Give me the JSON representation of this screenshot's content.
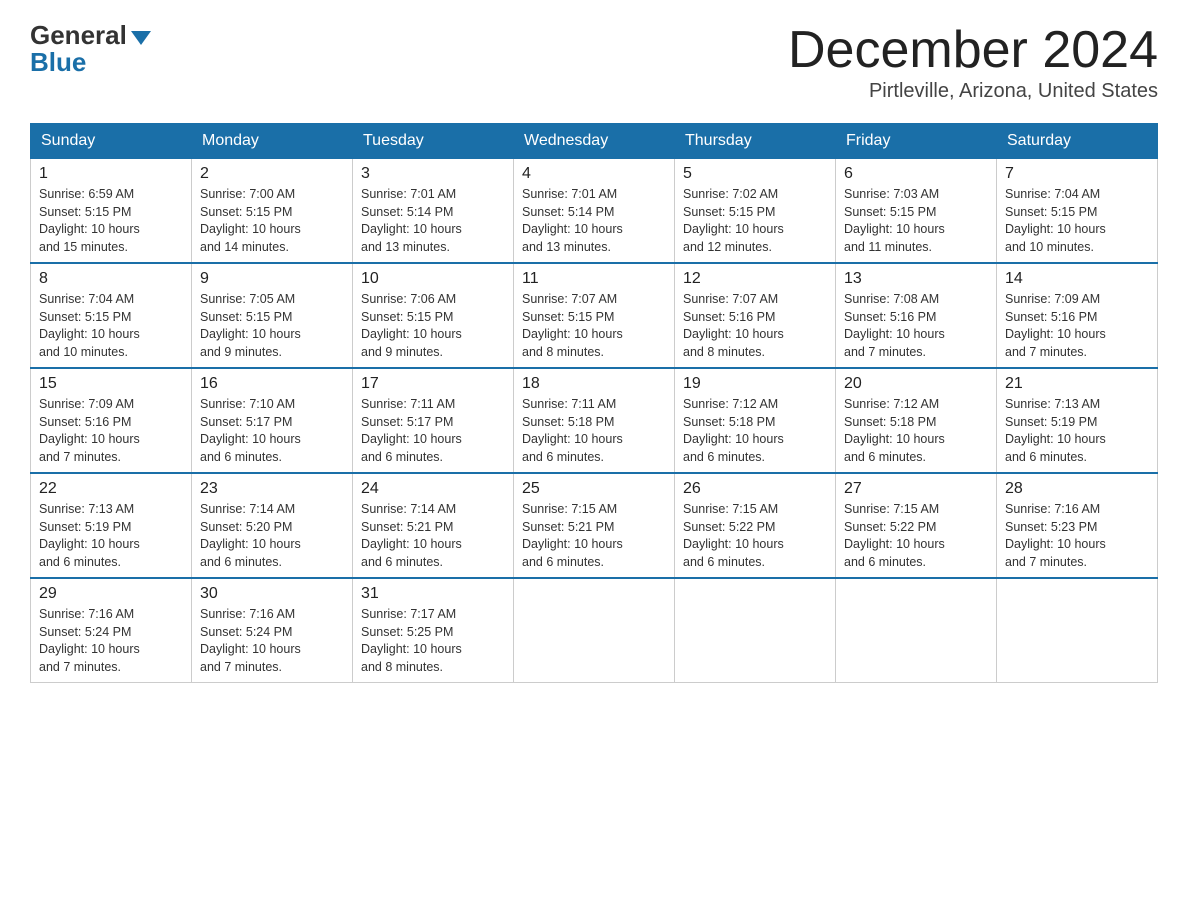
{
  "logo": {
    "general": "General",
    "blue": "Blue"
  },
  "title": "December 2024",
  "location": "Pirtleville, Arizona, United States",
  "days_of_week": [
    "Sunday",
    "Monday",
    "Tuesday",
    "Wednesday",
    "Thursday",
    "Friday",
    "Saturday"
  ],
  "weeks": [
    [
      {
        "day": "1",
        "sunrise": "6:59 AM",
        "sunset": "5:15 PM",
        "daylight": "10 hours and 15 minutes."
      },
      {
        "day": "2",
        "sunrise": "7:00 AM",
        "sunset": "5:15 PM",
        "daylight": "10 hours and 14 minutes."
      },
      {
        "day": "3",
        "sunrise": "7:01 AM",
        "sunset": "5:14 PM",
        "daylight": "10 hours and 13 minutes."
      },
      {
        "day": "4",
        "sunrise": "7:01 AM",
        "sunset": "5:14 PM",
        "daylight": "10 hours and 13 minutes."
      },
      {
        "day": "5",
        "sunrise": "7:02 AM",
        "sunset": "5:15 PM",
        "daylight": "10 hours and 12 minutes."
      },
      {
        "day": "6",
        "sunrise": "7:03 AM",
        "sunset": "5:15 PM",
        "daylight": "10 hours and 11 minutes."
      },
      {
        "day": "7",
        "sunrise": "7:04 AM",
        "sunset": "5:15 PM",
        "daylight": "10 hours and 10 minutes."
      }
    ],
    [
      {
        "day": "8",
        "sunrise": "7:04 AM",
        "sunset": "5:15 PM",
        "daylight": "10 hours and 10 minutes."
      },
      {
        "day": "9",
        "sunrise": "7:05 AM",
        "sunset": "5:15 PM",
        "daylight": "10 hours and 9 minutes."
      },
      {
        "day": "10",
        "sunrise": "7:06 AM",
        "sunset": "5:15 PM",
        "daylight": "10 hours and 9 minutes."
      },
      {
        "day": "11",
        "sunrise": "7:07 AM",
        "sunset": "5:15 PM",
        "daylight": "10 hours and 8 minutes."
      },
      {
        "day": "12",
        "sunrise": "7:07 AM",
        "sunset": "5:16 PM",
        "daylight": "10 hours and 8 minutes."
      },
      {
        "day": "13",
        "sunrise": "7:08 AM",
        "sunset": "5:16 PM",
        "daylight": "10 hours and 7 minutes."
      },
      {
        "day": "14",
        "sunrise": "7:09 AM",
        "sunset": "5:16 PM",
        "daylight": "10 hours and 7 minutes."
      }
    ],
    [
      {
        "day": "15",
        "sunrise": "7:09 AM",
        "sunset": "5:16 PM",
        "daylight": "10 hours and 7 minutes."
      },
      {
        "day": "16",
        "sunrise": "7:10 AM",
        "sunset": "5:17 PM",
        "daylight": "10 hours and 6 minutes."
      },
      {
        "day": "17",
        "sunrise": "7:11 AM",
        "sunset": "5:17 PM",
        "daylight": "10 hours and 6 minutes."
      },
      {
        "day": "18",
        "sunrise": "7:11 AM",
        "sunset": "5:18 PM",
        "daylight": "10 hours and 6 minutes."
      },
      {
        "day": "19",
        "sunrise": "7:12 AM",
        "sunset": "5:18 PM",
        "daylight": "10 hours and 6 minutes."
      },
      {
        "day": "20",
        "sunrise": "7:12 AM",
        "sunset": "5:18 PM",
        "daylight": "10 hours and 6 minutes."
      },
      {
        "day": "21",
        "sunrise": "7:13 AM",
        "sunset": "5:19 PM",
        "daylight": "10 hours and 6 minutes."
      }
    ],
    [
      {
        "day": "22",
        "sunrise": "7:13 AM",
        "sunset": "5:19 PM",
        "daylight": "10 hours and 6 minutes."
      },
      {
        "day": "23",
        "sunrise": "7:14 AM",
        "sunset": "5:20 PM",
        "daylight": "10 hours and 6 minutes."
      },
      {
        "day": "24",
        "sunrise": "7:14 AM",
        "sunset": "5:21 PM",
        "daylight": "10 hours and 6 minutes."
      },
      {
        "day": "25",
        "sunrise": "7:15 AM",
        "sunset": "5:21 PM",
        "daylight": "10 hours and 6 minutes."
      },
      {
        "day": "26",
        "sunrise": "7:15 AM",
        "sunset": "5:22 PM",
        "daylight": "10 hours and 6 minutes."
      },
      {
        "day": "27",
        "sunrise": "7:15 AM",
        "sunset": "5:22 PM",
        "daylight": "10 hours and 6 minutes."
      },
      {
        "day": "28",
        "sunrise": "7:16 AM",
        "sunset": "5:23 PM",
        "daylight": "10 hours and 7 minutes."
      }
    ],
    [
      {
        "day": "29",
        "sunrise": "7:16 AM",
        "sunset": "5:24 PM",
        "daylight": "10 hours and 7 minutes."
      },
      {
        "day": "30",
        "sunrise": "7:16 AM",
        "sunset": "5:24 PM",
        "daylight": "10 hours and 7 minutes."
      },
      {
        "day": "31",
        "sunrise": "7:17 AM",
        "sunset": "5:25 PM",
        "daylight": "10 hours and 8 minutes."
      },
      null,
      null,
      null,
      null
    ]
  ],
  "labels": {
    "sunrise": "Sunrise:",
    "sunset": "Sunset:",
    "daylight": "Daylight:"
  }
}
